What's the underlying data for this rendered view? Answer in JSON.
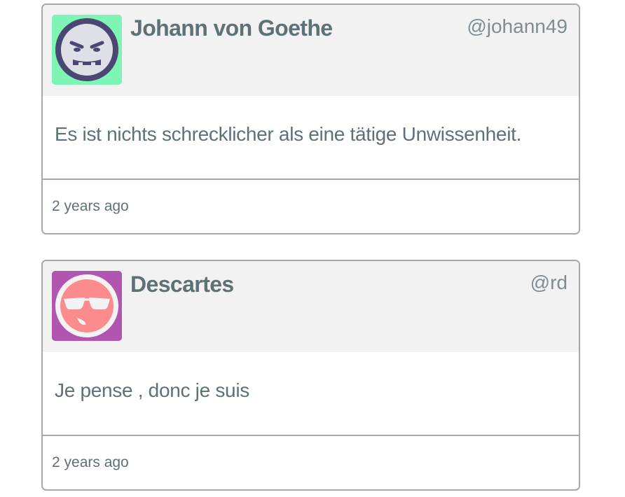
{
  "tweets": [
    {
      "avatar": {
        "icon": "angry-face-icon",
        "bg_color": "#7ff5b5",
        "face_color": "#dde0e6",
        "ring_color": "#4a4872"
      },
      "author": "Johann von Goethe",
      "handle": "@johann49",
      "text": "Es ist nichts schrecklicher als eine tätige Unwissenheit.",
      "time": "2 years ago"
    },
    {
      "avatar": {
        "icon": "sunglasses-face-icon",
        "bg_color": "#b056b0",
        "face_color": "#fb8b8d",
        "ring_color": "#f3f3f6"
      },
      "author": "Descartes",
      "handle": "@rd",
      "text": "Je pense , donc je suis",
      "time": "2 years ago"
    }
  ]
}
